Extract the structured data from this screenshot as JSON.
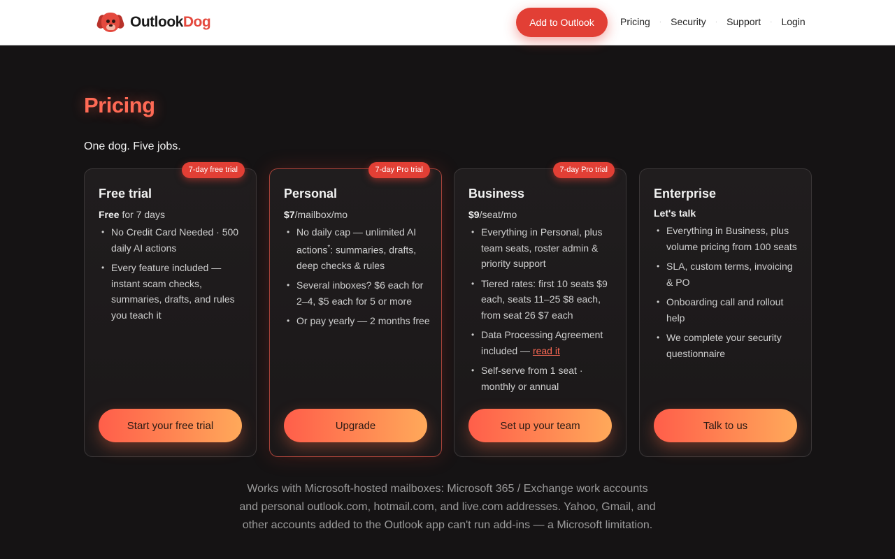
{
  "header": {
    "brand_part1": "Outlook",
    "brand_part2": "Dog",
    "cta_label": "Add to Outlook",
    "nav": [
      "Pricing",
      "Security",
      "Support",
      "Login"
    ],
    "separator": "·"
  },
  "page": {
    "title": "Pricing",
    "tagline": "One dog. Five jobs."
  },
  "plans": [
    {
      "badge": "7-day free trial",
      "name": "Free trial",
      "price_bold": "Free",
      "price_rest": " for 7 days",
      "features": [
        "No Credit Card Needed · 500 daily AI actions",
        "Every feature included — instant scam checks, summaries, drafts, and rules you teach it"
      ],
      "button": "Start your free trial"
    },
    {
      "badge": "7-day Pro trial",
      "name": "Personal",
      "price_bold": "$7",
      "price_rest": "/mailbox/mo",
      "feature1_pre": "No daily cap — unlimited AI actions",
      "feature1_sup": "*",
      "feature1_post": ": summaries, drafts, deep checks & rules",
      "features": [
        "Several inboxes? $6 each for 2–4, $5 each for 5 or more",
        "Or pay yearly — 2 months free"
      ],
      "button": "Upgrade"
    },
    {
      "badge": "7-day Pro trial",
      "name": "Business",
      "price_bold": "$9",
      "price_rest": "/seat/mo",
      "features": [
        "Everything in Personal, plus team seats, roster admin & priority support",
        "Tiered rates: first 10 seats $9 each, seats 11–25 $8 each, from seat 26 $7 each"
      ],
      "dpa_pre": "Data Processing Agreement included — ",
      "dpa_link": "read it",
      "feature_last": "Self-serve from 1 seat · monthly or annual",
      "button": "Set up your team"
    },
    {
      "name": "Enterprise",
      "price_bold": "Let's talk",
      "features": [
        "Everything in Business, plus volume pricing from 100 seats",
        "SLA, custom terms, invoicing & PO",
        "Onboarding call and rollout help",
        "We complete your security questionnaire"
      ],
      "button": "Talk to us"
    }
  ],
  "footnote": "Works with Microsoft-hosted mailboxes: Microsoft 365 / Exchange work accounts and personal outlook.com, hotmail.com, and live.com addresses. Yahoo, Gmail, and other accounts added to the Outlook app can't run add-ins — a Microsoft limitation.",
  "colors": {
    "accent": "#e23f35",
    "title": "#ff6a55",
    "gradient_start": "#ff5e4a",
    "gradient_end": "#ffa95a",
    "background": "#151314"
  }
}
